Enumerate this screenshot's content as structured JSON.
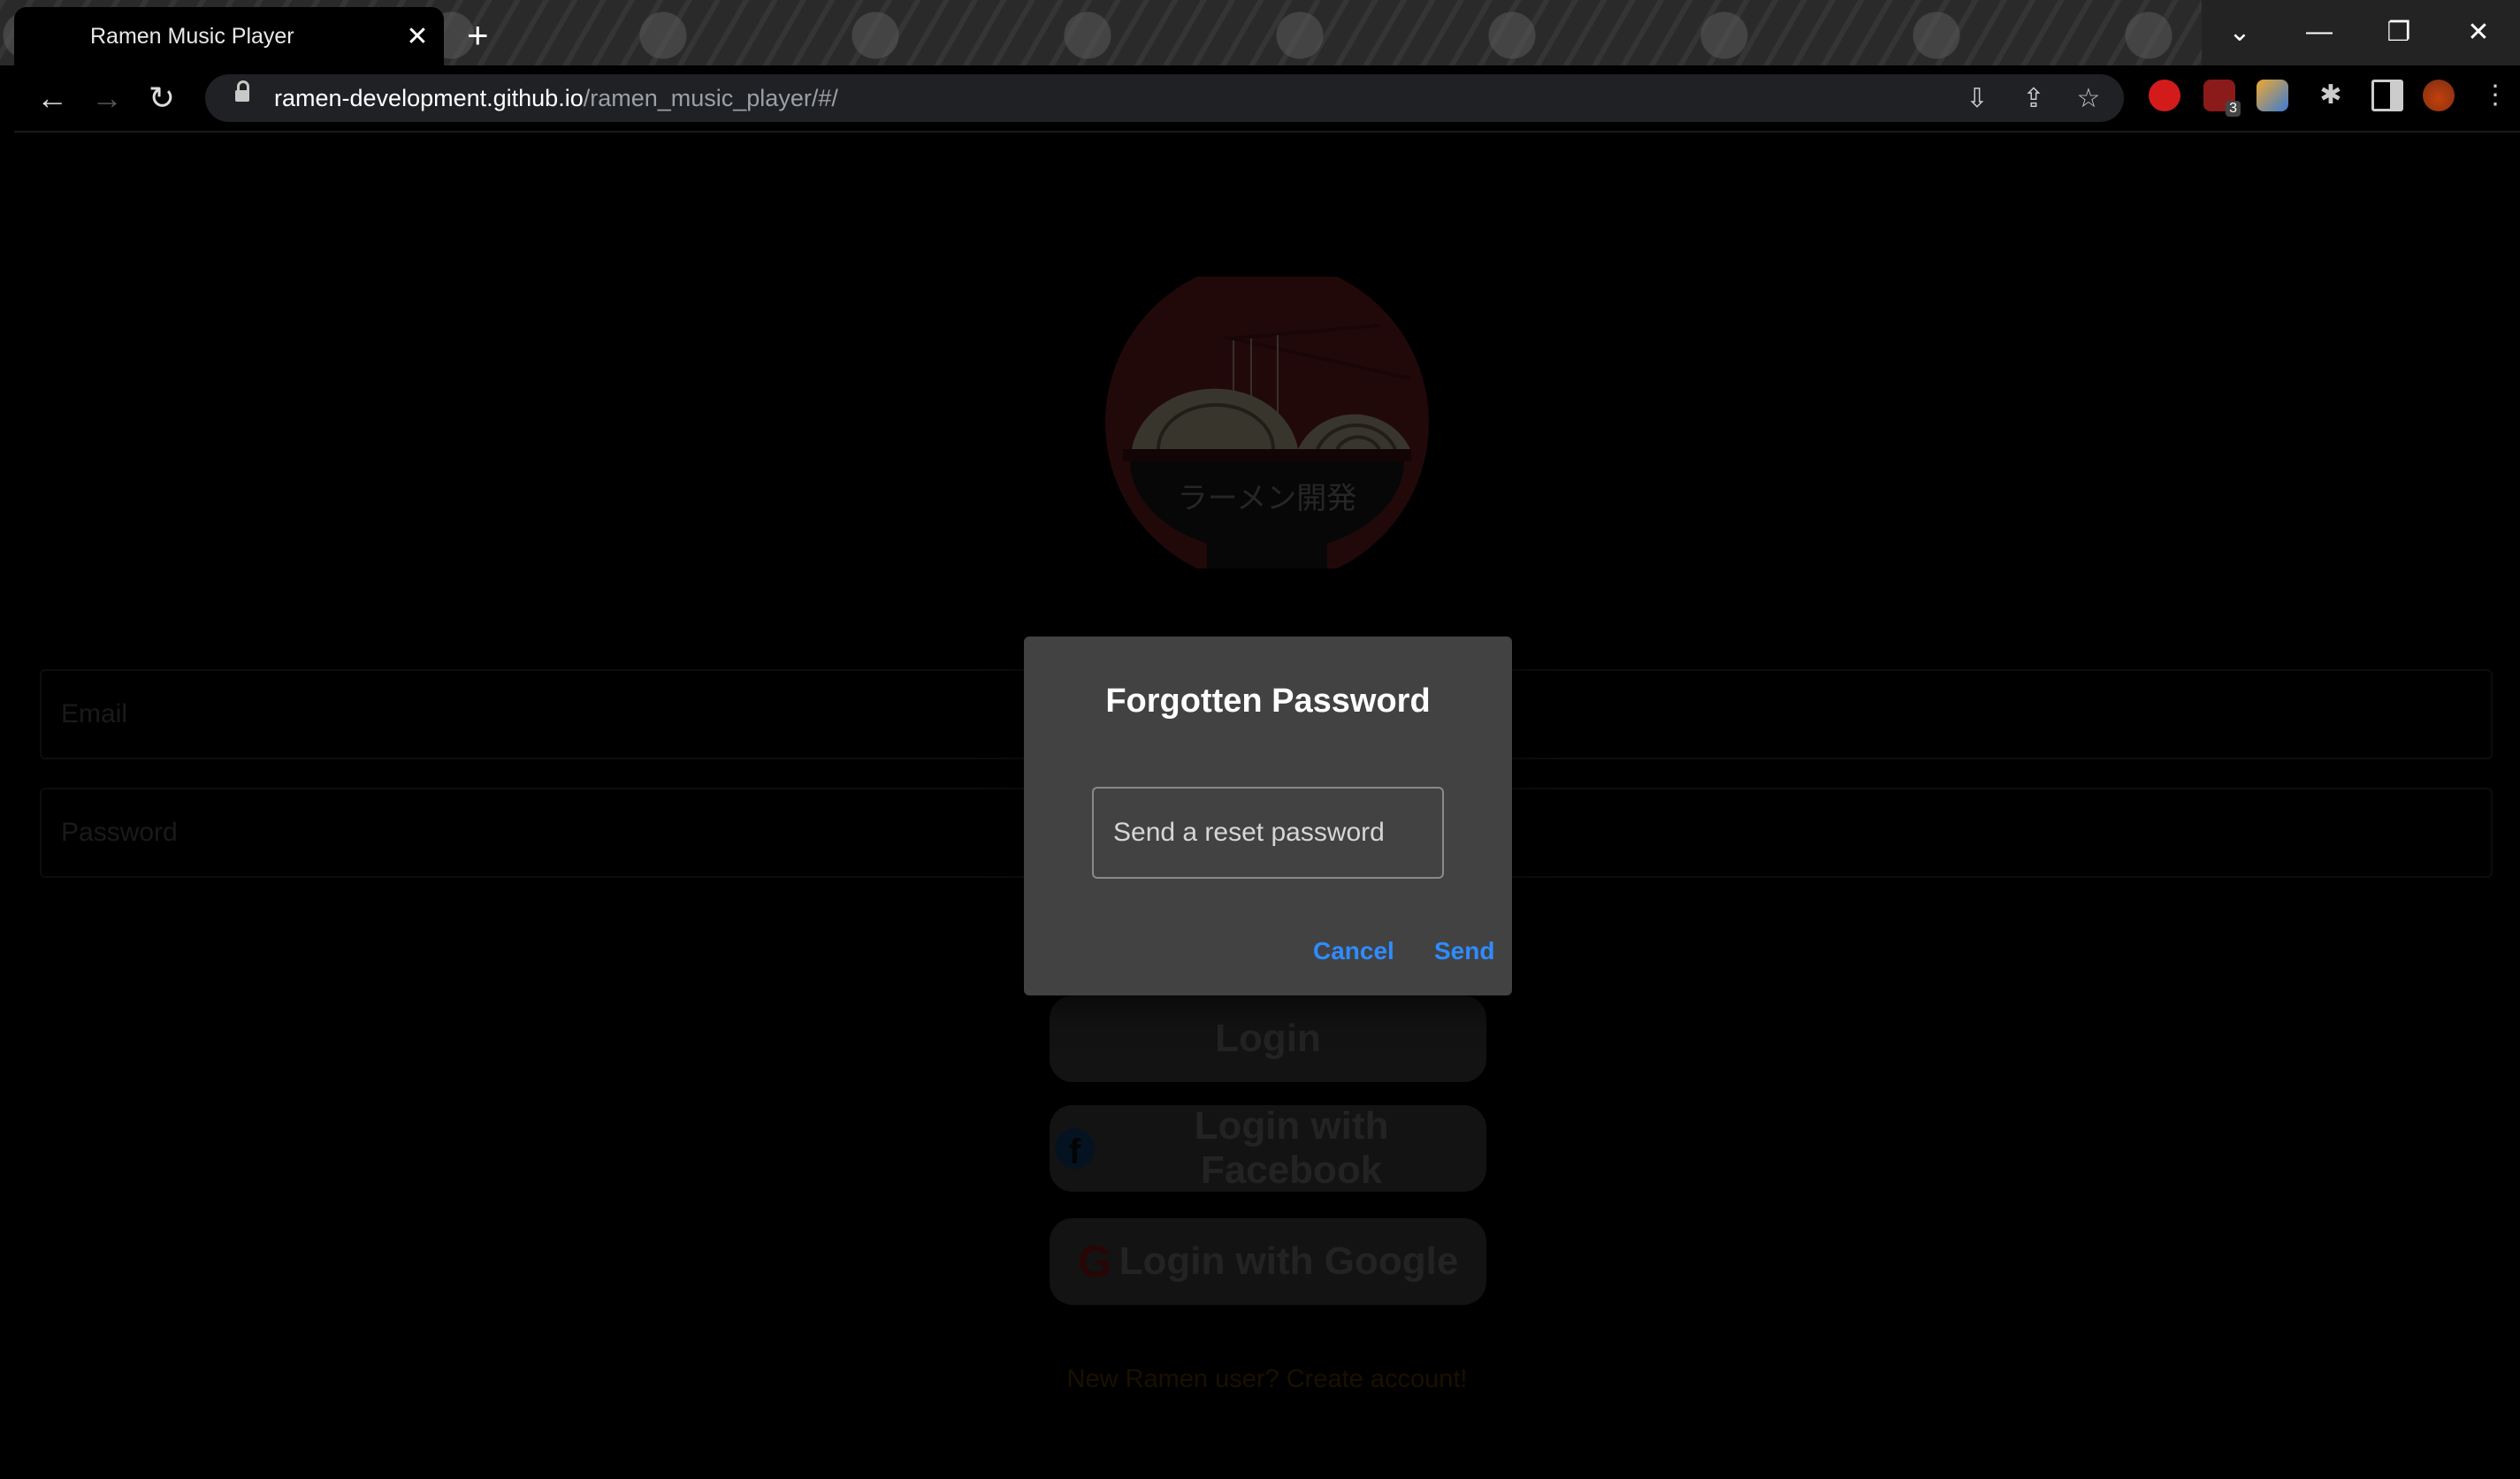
{
  "browser": {
    "tab_title": "Ramen Music Player",
    "tab_close": "✕",
    "new_tab": "+",
    "url_host": "ramen-development.github.io",
    "url_path": "/ramen_music_player/#/",
    "ext_badge": "3"
  },
  "logo": {
    "text": "ラーメン開発"
  },
  "form": {
    "email_placeholder": "Email",
    "password_placeholder": "Password",
    "login_label": "Login",
    "facebook_label": "Login with Facebook",
    "facebook_icon": "f",
    "google_label": "Login with Google",
    "google_icon": "G",
    "signup_text": "New Ramen user? Create account!"
  },
  "dialog": {
    "title": "Forgotten Password",
    "input_placeholder": "Send a reset password",
    "cancel_label": "Cancel",
    "send_label": "Send"
  },
  "colors": {
    "page_background": "#000000",
    "dialog_background": "#424242",
    "dialog_action": "#2f8cff",
    "logo_red": "#4a1418"
  }
}
